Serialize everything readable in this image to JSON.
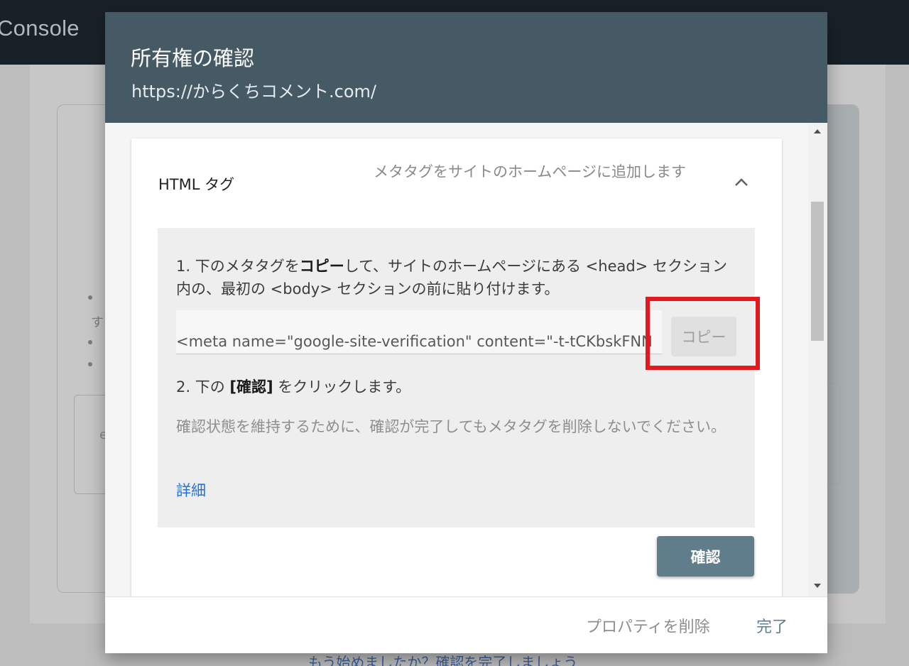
{
  "background": {
    "brand": "Console",
    "fragment_text": "す",
    "fragment_text2": "e",
    "bottom_link": "もう始めましたか？確認を完了しましょう"
  },
  "dialog": {
    "title": "所有権の確認",
    "subtitle": "https://からくちコメント.com/",
    "method": {
      "title": "HTML タグ",
      "description": "メタタグをサイトのホームページに追加します",
      "expanded": true,
      "step1": {
        "prefix": "1. 下のメタタグを",
        "bold": "コピー",
        "suffix": "して、サイトのホームページにある <head> セクション内の、最初の <body> セクションの前に貼り付けます。"
      },
      "meta_tag": "<meta name=\"google-site-verification\" content=\"-t-tCKbskFNN",
      "copy_label": "コピー",
      "step2": {
        "prefix": "2. 下の ",
        "bold": "[確認]",
        "suffix": " をクリックします。"
      },
      "note": "確認状態を維持するために、確認が完了してもメタタグを削除しないでください。",
      "detail_link": "詳細",
      "confirm_label": "確認"
    },
    "footer": {
      "delete_label": "プロパティを削除",
      "done_label": "完了"
    }
  },
  "colors": {
    "header": "#455a64",
    "confirm_button": "#607d8b",
    "highlight": "#e3191e",
    "link": "#1a73e8"
  }
}
